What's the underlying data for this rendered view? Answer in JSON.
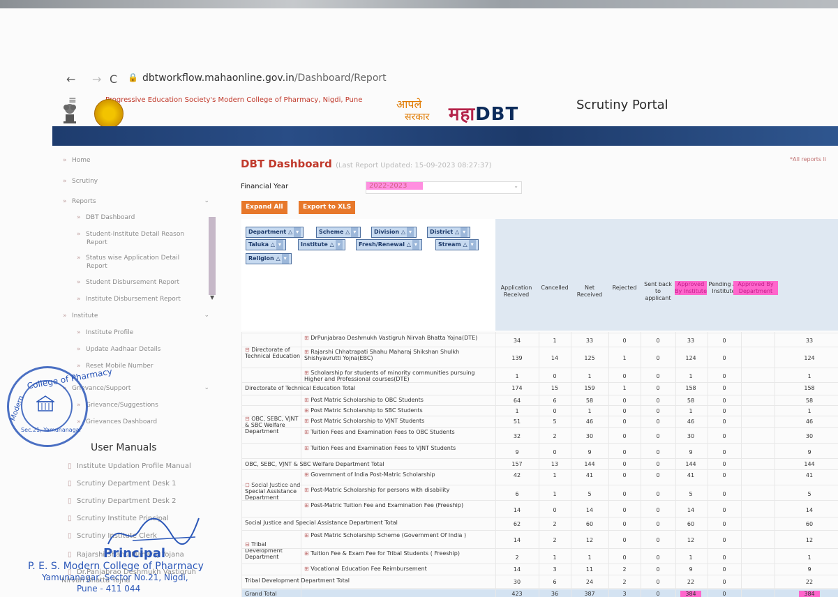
{
  "browser": {
    "url_host": "dbtworkflow.mahaonline.gov.in",
    "url_path": "/Dashboard/Report",
    "back_icon": "←",
    "forward_icon": "→",
    "reload_icon": "C",
    "lock_icon": "🔒",
    "menu_icon": "≡"
  },
  "header": {
    "college_name": "Progressive Education Society's Modern College of Pharmacy, Nigdi, Pune",
    "aaple": "आपले",
    "sarkar": "सरकार",
    "maha": "महा",
    "dbt": "DBT",
    "portal": "Scrutiny Portal",
    "all_reports": "*All reports li"
  },
  "sidebar": {
    "items": [
      {
        "label": "Home"
      },
      {
        "label": "Scrutiny"
      },
      {
        "label": "Reports"
      }
    ],
    "reports_sub": [
      {
        "label": "DBT Dashboard"
      },
      {
        "label": "Student-Institute Detail Reason"
      },
      {
        "label": "Report"
      },
      {
        "label": "Status wise Application Detail"
      },
      {
        "label": "Report"
      },
      {
        "label": "Student Disbursement Report"
      },
      {
        "label": "Institute Disbursement Report"
      }
    ],
    "institute": "Institute",
    "institute_sub": [
      {
        "label": "Institute Profile"
      },
      {
        "label": "Update Aadhaar Details"
      },
      {
        "label": "Reset Mobile Number"
      }
    ],
    "grievance": "Grievance/Support",
    "grievance_sub": [
      {
        "label": "Grievance/Suggestions"
      },
      {
        "label": "Grievances Dashboard"
      }
    ],
    "manuals_title": "User Manuals",
    "manuals": [
      {
        "label": "Institute Updation Profile Manual"
      },
      {
        "label": "Scrutiny Department Desk 1"
      },
      {
        "label": "Scrutiny Department Desk 2"
      },
      {
        "label": "Scrutiny Institute Principal"
      },
      {
        "label": "Scrutiny Institute Clerk"
      },
      {
        "label": "Rajarshi Shahu Maharaj Yojana"
      },
      {
        "label": "Dr.Panjabrao Deshmukh Vastigruh"
      },
      {
        "label": "Nirvah Bhatta Yojna"
      }
    ]
  },
  "stamp": {
    "ring_text": "College of Pharmacy",
    "left_text": "Modern",
    "bottom_text": "Sec.21, Yamunanagar",
    "principal": "Principal",
    "line1": "P. E. S. Modern College of Pharmacy",
    "line2": "Yamunanagar, Sector No.21, Nigdi,",
    "line3": "Pune - 411 044"
  },
  "dashboard": {
    "title": "DBT Dashboard",
    "last_updated": "(Last Report Updated: 15-09-2023 08:27:37)",
    "fy_label": "Financial Year",
    "fy_value": "2022-2023",
    "expand_all": "Expand All",
    "export_xls": "Export to XLS",
    "chips": [
      "Department",
      "Scheme",
      "Division",
      "District",
      "Taluka",
      "Institute",
      "Fresh/Renewal",
      "Stream",
      "Religion"
    ],
    "columns": [
      "Application Received",
      "Cancelled",
      "Net Received",
      "Rejected",
      "Sent back to applicant",
      "Approved By Institute",
      "Pending At Institute",
      "Approved By Department"
    ],
    "rows": [
      {
        "dept": "Directorate of Technical Education",
        "scheme": "DrPunjabrao Deshmukh Vastigruh Nirvah Bhatta Yojna(DTE)",
        "v": [
          "34",
          "1",
          "33",
          "0",
          "0",
          "33",
          "0",
          "33"
        ]
      },
      {
        "dept": "",
        "scheme": "Rajarshi Chhatrapati Shahu Maharaj Shikshan Shulkh Shishyavrutti Yojna(EBC)",
        "v": [
          "139",
          "14",
          "125",
          "1",
          "0",
          "124",
          "0",
          "124"
        ]
      },
      {
        "dept": "",
        "scheme": "Scholarship for students of minority communities pursuing Higher and Professional courses(DTE)",
        "v": [
          "1",
          "0",
          "1",
          "0",
          "0",
          "1",
          "0",
          "1"
        ]
      },
      {
        "total": "Directorate of Technical Education Total",
        "v": [
          "174",
          "15",
          "159",
          "1",
          "0",
          "158",
          "0",
          "158"
        ]
      },
      {
        "dept": "OBC, SEBC, VJNT & SBC Welfare Department",
        "scheme": "Post Matric Scholarship to OBC Students",
        "v": [
          "64",
          "6",
          "58",
          "0",
          "0",
          "58",
          "0",
          "58"
        ]
      },
      {
        "dept": "",
        "scheme": "Post Matric Scholarship to SBC Students",
        "v": [
          "1",
          "0",
          "1",
          "0",
          "0",
          "1",
          "0",
          "1"
        ]
      },
      {
        "dept": "",
        "scheme": "Post Matric Scholarship to VJNT Students",
        "v": [
          "51",
          "5",
          "46",
          "0",
          "0",
          "46",
          "0",
          "46"
        ]
      },
      {
        "dept": "",
        "scheme": "Tuition Fees and Examination Fees to OBC Students",
        "v": [
          "32",
          "2",
          "30",
          "0",
          "0",
          "30",
          "0",
          "30"
        ]
      },
      {
        "dept": "",
        "scheme": "Tuition Fees and Examination Fees to VJNT Students",
        "v": [
          "9",
          "0",
          "9",
          "0",
          "0",
          "9",
          "0",
          "9"
        ]
      },
      {
        "total": "OBC, SEBC, VJNT & SBC Welfare Department Total",
        "v": [
          "157",
          "13",
          "144",
          "0",
          "0",
          "144",
          "0",
          "144"
        ]
      },
      {
        "dept": "Social Justice and Special Assistance Department",
        "scheme": "Government of India Post-Matric Scholarship",
        "v": [
          "42",
          "1",
          "41",
          "0",
          "0",
          "41",
          "0",
          "41"
        ]
      },
      {
        "dept": "",
        "scheme": "Post-Matric Scholarship for persons with disability",
        "v": [
          "6",
          "1",
          "5",
          "0",
          "0",
          "5",
          "0",
          "5"
        ]
      },
      {
        "dept": "",
        "scheme": "Post-Matric Tuition Fee and Examination Fee (Freeship)",
        "v": [
          "14",
          "0",
          "14",
          "0",
          "0",
          "14",
          "0",
          "14"
        ]
      },
      {
        "total": "Social Justice and Special Assistance Department Total",
        "v": [
          "62",
          "2",
          "60",
          "0",
          "0",
          "60",
          "0",
          "60"
        ]
      },
      {
        "dept": "Tribal Development Department",
        "scheme": "Post Matric Scholarship Scheme (Government Of India )",
        "v": [
          "14",
          "2",
          "12",
          "0",
          "0",
          "12",
          "0",
          "12"
        ]
      },
      {
        "dept": "",
        "scheme": "Tuition Fee & Exam Fee for Tribal Students ( Freeship)",
        "v": [
          "2",
          "1",
          "1",
          "0",
          "0",
          "1",
          "0",
          "1"
        ]
      },
      {
        "dept": "",
        "scheme": "Vocational Education Fee Reimbursement",
        "v": [
          "14",
          "3",
          "11",
          "2",
          "0",
          "9",
          "0",
          "9"
        ]
      },
      {
        "total": "Tribal Development Department Total",
        "v": [
          "30",
          "6",
          "24",
          "2",
          "0",
          "22",
          "0",
          "22"
        ]
      },
      {
        "total": "Grand Total",
        "v": [
          "423",
          "36",
          "387",
          "3",
          "0",
          "384",
          "0",
          "384"
        ]
      }
    ]
  }
}
